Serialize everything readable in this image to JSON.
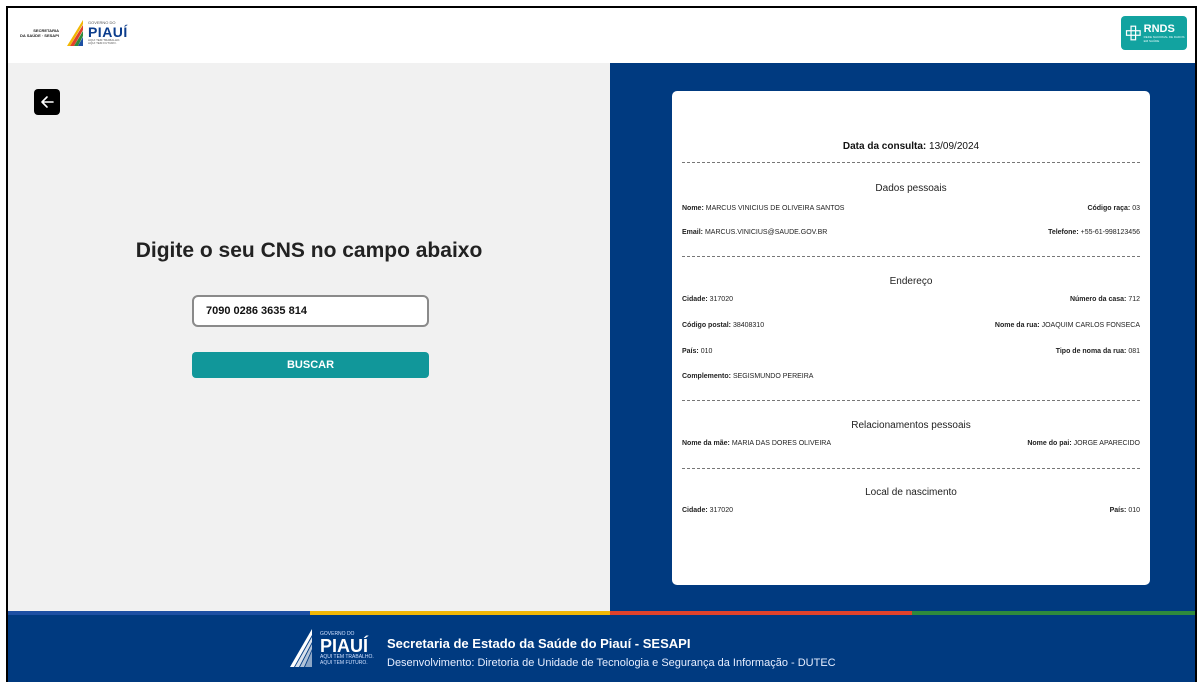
{
  "header": {
    "sesapi_line1": "SECRETARIA",
    "sesapi_line2": "DA SAÚDE · SESAPI",
    "gov_small": "GOVERNO DO",
    "gov_big": "PIAUÍ",
    "gov_tag1": "AQUI TEM TRABALHO.",
    "gov_tag2": "AQUI TEM FUTURO.",
    "rnds_text": "RNDS",
    "rnds_sub": "REDE NACIONAL DE DADOS EM SAÚDE"
  },
  "search": {
    "title": "Digite o seu CNS no campo abaixo",
    "value": "7090 0286 3635 814",
    "button_label": "BUSCAR"
  },
  "card": {
    "date_label": "Data da consulta:",
    "date_value": "13/09/2024",
    "personal": {
      "title": "Dados pessoais",
      "nome_label": "Nome:",
      "nome_value": "MARCUS VINICIUS DE OLIVEIRA SANTOS",
      "raca_label": "Código raça:",
      "raca_value": "03",
      "email_label": "Email:",
      "email_value": "MARCUS.VINICIUS@SAUDE.GOV.BR",
      "telefone_label": "Telefone:",
      "telefone_value": "+55-61-998123456"
    },
    "address": {
      "title": "Endereço",
      "cidade_label": "Cidade:",
      "cidade_value": "317020",
      "numero_label": "Número da casa:",
      "numero_value": "712",
      "cep_label": "Código postal:",
      "cep_value": "38408310",
      "rua_label": "Nome da rua:",
      "rua_value": "JOAQUIM CARLOS FONSECA",
      "pais_label": "País:",
      "pais_value": "010",
      "tipo_label": "Tipo de noma da rua:",
      "tipo_value": "081",
      "complemento_label": "Complemento:",
      "complemento_value": "SEGISMUNDO PEREIRA"
    },
    "relations": {
      "title": "Relacionamentos pessoais",
      "mae_label": "Nome da mãe:",
      "mae_value": "MARIA DAS DORES OLIVEIRA",
      "pai_label": "Nome do pai:",
      "pai_value": "JORGE APARECIDO"
    },
    "birth": {
      "title": "Local de nascimento",
      "cidade_label": "Cidade:",
      "cidade_value": "317020",
      "pais_label": "País:",
      "pais_value": "010"
    }
  },
  "footer": {
    "logo_small": "GOVERNO DO",
    "logo_big": "PIAUÍ",
    "logo_tag1": "AQUI TEM TRABALHO.",
    "logo_tag2": "AQUI TEM FUTURO.",
    "title": "Secretaria de Estado da Saúde do Piauí - SESAPI",
    "subtitle": "Desenvolvimento: Diretoria de Unidade de Tecnologia e Segurança da Informação - DUTEC"
  },
  "colors": {
    "navy": "#003a80",
    "teal": "#11979a",
    "stripe_blue": "#1d4fa3",
    "stripe_yellow": "#f2b705",
    "stripe_red": "#e0422b",
    "stripe_green": "#2e8a3c"
  },
  "icons": {
    "back": "arrow-left-icon",
    "gov_logo": "piaui-flag-icon"
  }
}
